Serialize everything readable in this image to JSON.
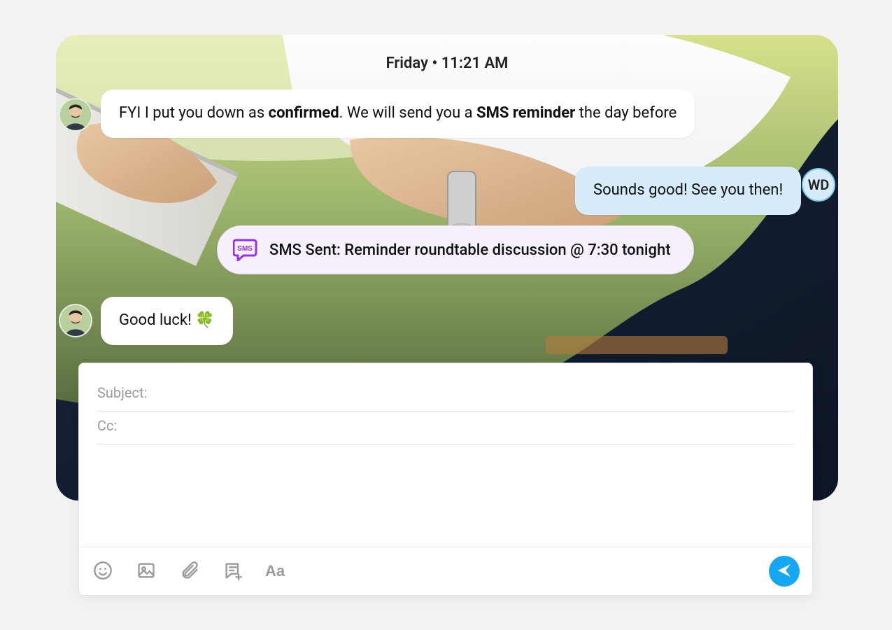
{
  "timestamp": "Friday • 11:21 AM",
  "messages": {
    "m1_prefix": "FYI I put you down as ",
    "m1_bold1": "confirmed",
    "m1_mid": ". We will send you a ",
    "m1_bold2": "SMS reminder",
    "m1_suffix": " the day before",
    "m2": "Sounds good! See you then!",
    "sms": "SMS Sent: Reminder roundtable discussion @ 7:30 tonight",
    "m3": "Good luck! 🍀"
  },
  "avatar2_initials": "WD",
  "composer": {
    "subject_label": "Subject:",
    "cc_label": "Cc:",
    "subject_value": "",
    "cc_value": "",
    "body_value": "",
    "text_tool_label": "Aa"
  }
}
